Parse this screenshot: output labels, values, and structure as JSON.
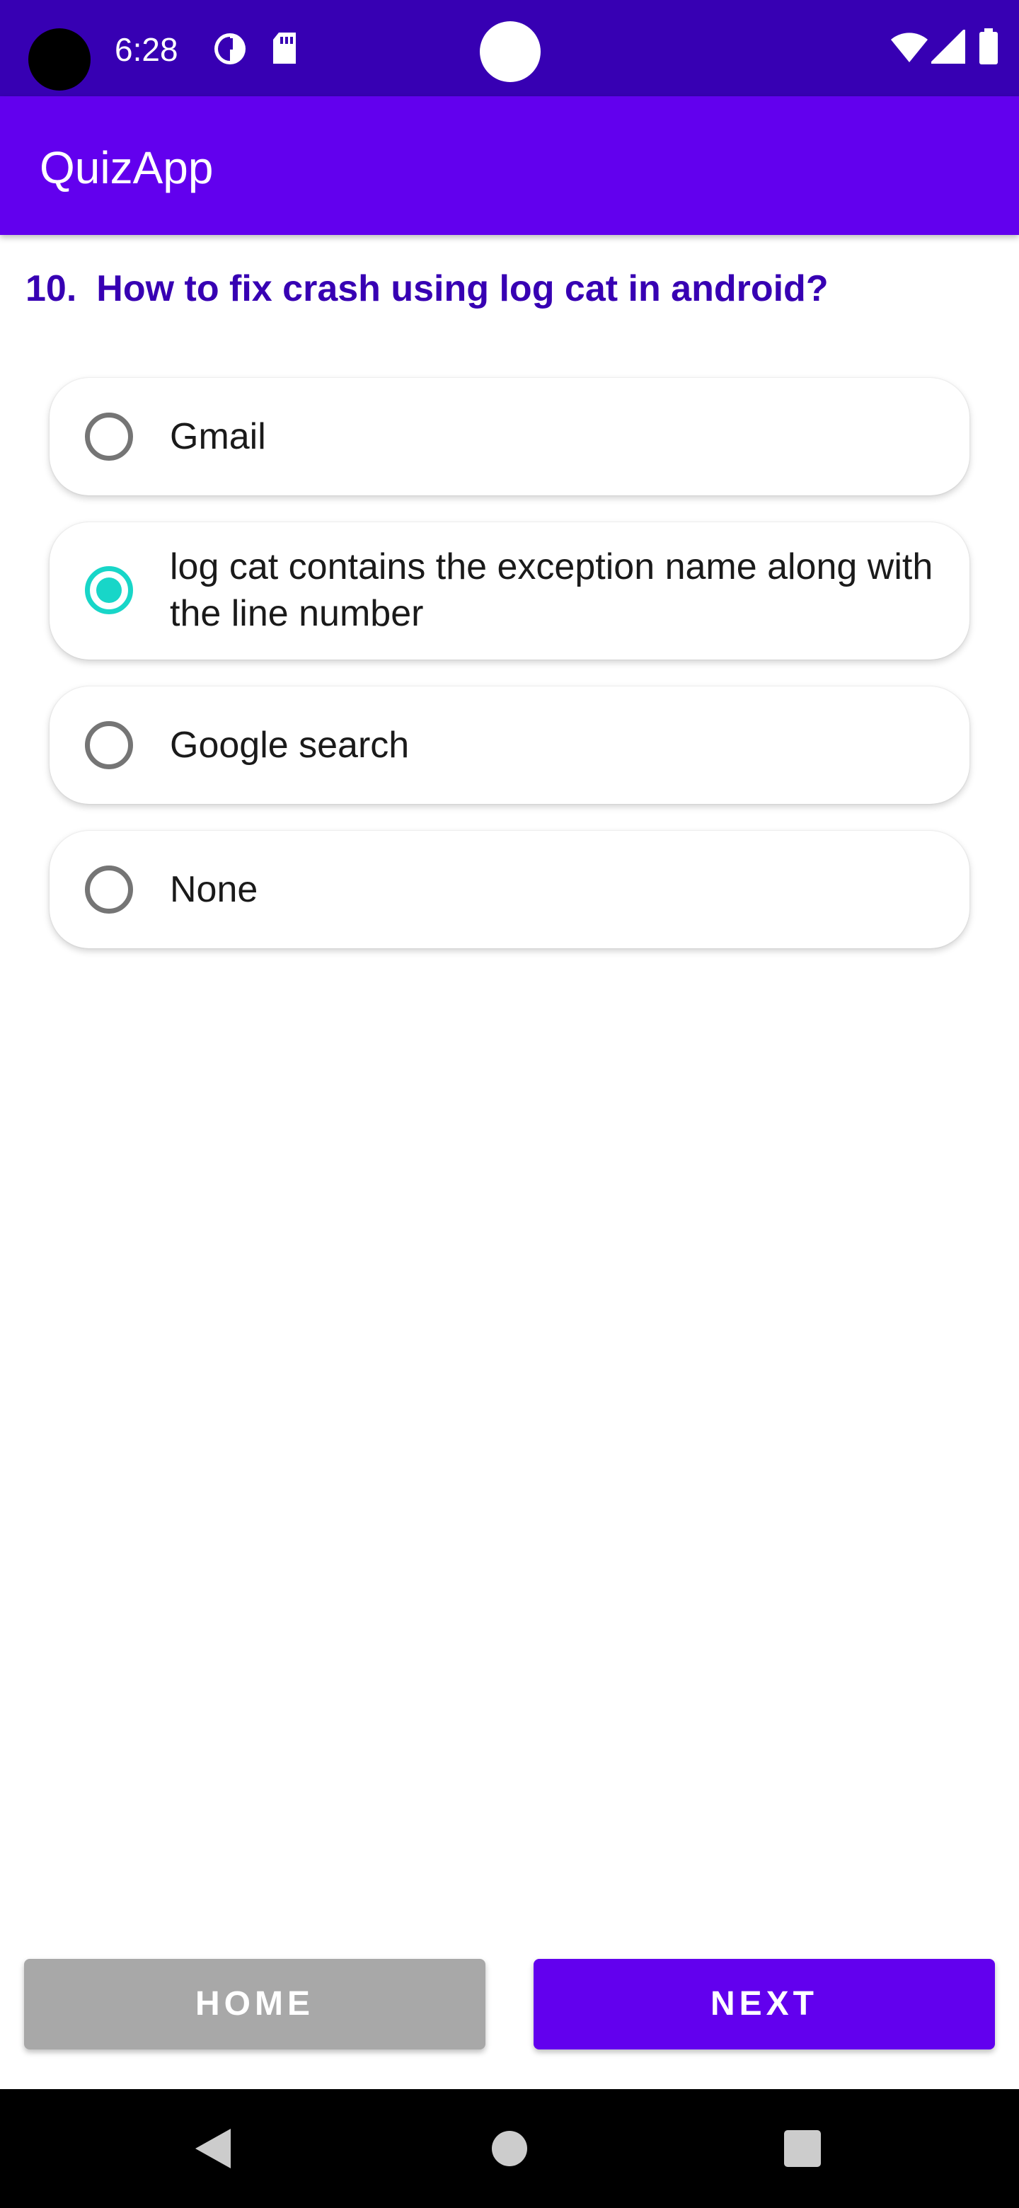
{
  "status_bar": {
    "time": "6:28",
    "icons": [
      "camera-hole",
      "data-saver-icon",
      "sd-card-icon",
      "wifi-icon",
      "signal-icon",
      "battery-icon"
    ],
    "background": "#3700b3"
  },
  "app_bar": {
    "title": "QuizApp",
    "background": "#6200ee"
  },
  "question": {
    "number": "10.",
    "text": "How to fix crash using log cat in android?",
    "color": "#3700b3"
  },
  "options": [
    {
      "label": "Gmail",
      "selected": false
    },
    {
      "label": "log cat contains the exception name along with the line number",
      "selected": true
    },
    {
      "label": "Google search",
      "selected": false
    },
    {
      "label": "None",
      "selected": false
    }
  ],
  "radio_checked_color": "#18d6c8",
  "buttons": {
    "home_label": "HOME",
    "next_label": "NEXT",
    "home_color": "#a8a8a8",
    "next_color": "#6200ee"
  },
  "nav_bar": {
    "icons": [
      "back-icon",
      "home-icon",
      "recents-icon"
    ]
  }
}
